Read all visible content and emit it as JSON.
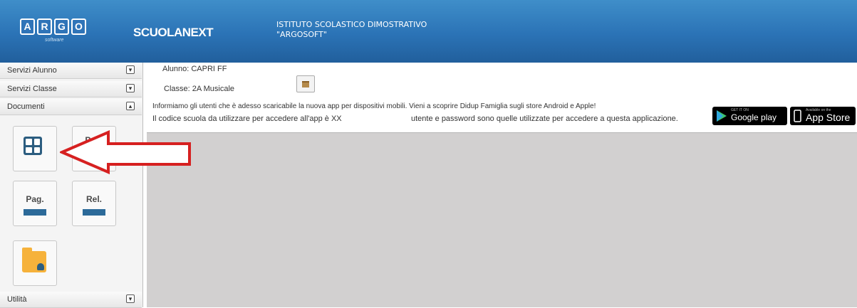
{
  "header": {
    "logo_letters": [
      "A",
      "R",
      "G",
      "O"
    ],
    "logo_sub": "software",
    "brand": "SCUOLANEXT",
    "school_line1": "ISTITUTO SCOLASTICO DIMOSTRATIVO",
    "school_line2": "\"ARGOSOFT\""
  },
  "sidebar": {
    "sections": [
      {
        "label": "Servizi Alunno",
        "toggle": "▾"
      },
      {
        "label": "Servizi Classe",
        "toggle": "▾"
      },
      {
        "label": "Documenti",
        "toggle": "▴"
      },
      {
        "label": "Utilità",
        "toggle": "▾"
      }
    ],
    "tiles": [
      {
        "label": "Pag."
      },
      {
        "label": "Pag."
      },
      {
        "label": "Rel."
      }
    ]
  },
  "main": {
    "alunno": "Alunno: CAPRI FF",
    "classe": "Classe: 2A Musicale",
    "info_line1": "Informiamo gli utenti che è adesso scaricabile la nuova app per dispositivi mobili. Vieni a scoprire Didup Famiglia sugli store Android e Apple!",
    "info_line2a": "Il codice scuola da utilizzare per accedere all'app è XX",
    "info_line2b": "utente e password sono quelle utilizzate per accedere a questa applicazione.",
    "google_small": "GET IT ON",
    "google_big": "Google play",
    "apple_small": "Available on the",
    "apple_big": "App Store"
  },
  "colors": {
    "header": "#2b73b6",
    "arrow": "#d62020",
    "tile_icon": "#2c5d80",
    "folder": "#f6b23b"
  }
}
